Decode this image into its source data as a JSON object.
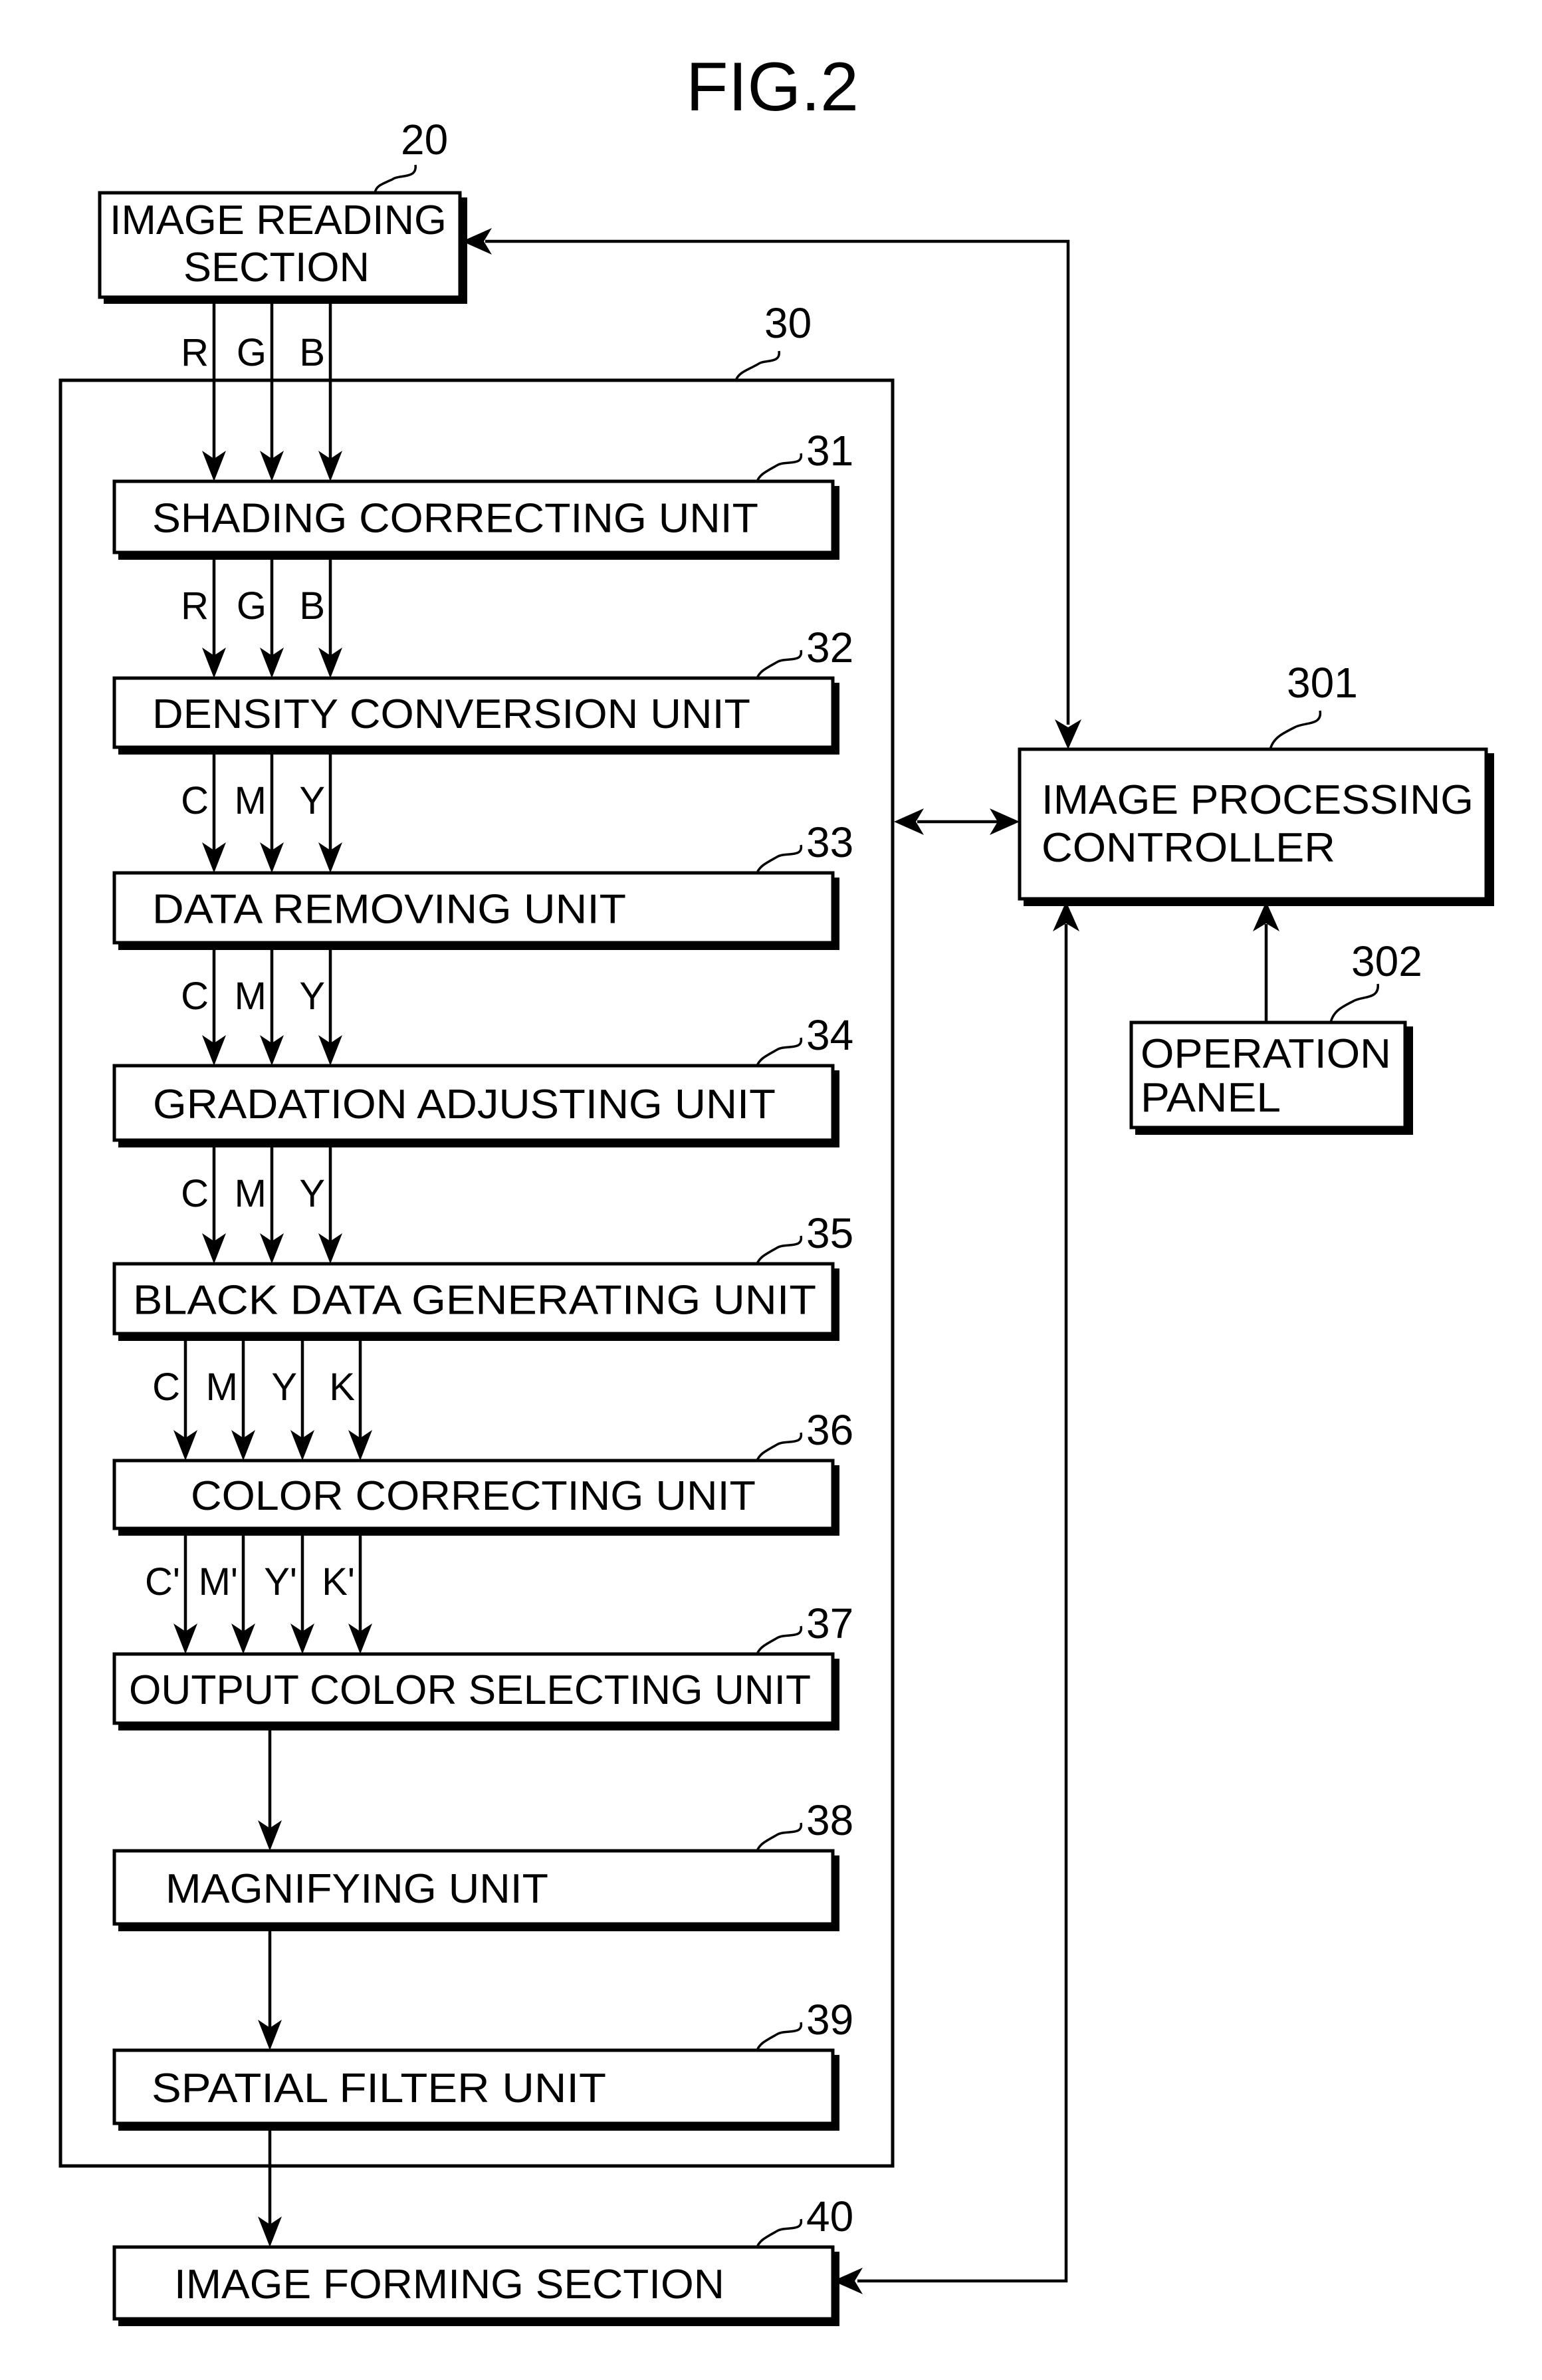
{
  "figure": {
    "title": "FIG.2",
    "ink_color": "#000000",
    "paper_color": "#ffffff"
  },
  "blocks": {
    "image_reading_section": {
      "ref": "20",
      "lines": [
        "IMAGE READING",
        "SECTION"
      ]
    },
    "image_processing_unit": {
      "ref": "30"
    },
    "shading_correcting_unit": {
      "ref": "31",
      "label": "SHADING CORRECTING UNIT"
    },
    "density_conversion_unit": {
      "ref": "32",
      "label": "DENSITY CONVERSION UNIT"
    },
    "data_removing_unit": {
      "ref": "33",
      "label": "DATA REMOVING UNIT"
    },
    "gradation_adjusting_unit": {
      "ref": "34",
      "label": "GRADATION ADJUSTING UNIT"
    },
    "black_data_generating_unit": {
      "ref": "35",
      "label": "BLACK DATA GENERATING UNIT"
    },
    "color_correcting_unit": {
      "ref": "36",
      "label": "COLOR CORRECTING UNIT"
    },
    "output_color_selecting_unit": {
      "ref": "37",
      "label": "OUTPUT COLOR SELECTING UNIT"
    },
    "magnifying_unit": {
      "ref": "38",
      "label": "MAGNIFYING UNIT"
    },
    "spatial_filter_unit": {
      "ref": "39",
      "label": "SPATIAL FILTER UNIT"
    },
    "image_forming_section": {
      "ref": "40",
      "label": "IMAGE FORMING SECTION"
    },
    "image_processing_controller": {
      "ref": "301",
      "lines": [
        "IMAGE PROCESSING",
        "CONTROLLER"
      ]
    },
    "operation_panel": {
      "ref": "302",
      "lines": [
        "OPERATION",
        "PANEL"
      ]
    }
  },
  "signals": [
    {
      "from": "image_reading_section",
      "to": "shading_correcting_unit",
      "channels": [
        "R",
        "G",
        "B"
      ]
    },
    {
      "from": "shading_correcting_unit",
      "to": "density_conversion_unit",
      "channels": [
        "R",
        "G",
        "B"
      ]
    },
    {
      "from": "density_conversion_unit",
      "to": "data_removing_unit",
      "channels": [
        "C",
        "M",
        "Y"
      ]
    },
    {
      "from": "data_removing_unit",
      "to": "gradation_adjusting_unit",
      "channels": [
        "C",
        "M",
        "Y"
      ]
    },
    {
      "from": "gradation_adjusting_unit",
      "to": "black_data_generating_unit",
      "channels": [
        "C",
        "M",
        "Y"
      ]
    },
    {
      "from": "black_data_generating_unit",
      "to": "color_correcting_unit",
      "channels": [
        "C",
        "M",
        "Y",
        "K"
      ]
    },
    {
      "from": "color_correcting_unit",
      "to": "output_color_selecting_unit",
      "channels": [
        "C'",
        "M'",
        "Y'",
        "K'"
      ]
    },
    {
      "from": "output_color_selecting_unit",
      "to": "magnifying_unit",
      "channels": []
    },
    {
      "from": "magnifying_unit",
      "to": "spatial_filter_unit",
      "channels": []
    },
    {
      "from": "spatial_filter_unit",
      "to": "image_forming_section",
      "channels": []
    }
  ],
  "control_links": [
    {
      "from": "image_processing_controller",
      "to": "image_reading_section",
      "direction": "one-way"
    },
    {
      "from": "image_processing_controller",
      "to": "image_processing_unit",
      "direction": "two-way"
    },
    {
      "from": "image_processing_controller",
      "to": "image_forming_section",
      "direction": "one-way"
    },
    {
      "from": "image_forming_section",
      "to": "image_processing_controller",
      "direction": "one-way"
    },
    {
      "from": "operation_panel",
      "to": "image_processing_controller",
      "direction": "one-way"
    }
  ]
}
